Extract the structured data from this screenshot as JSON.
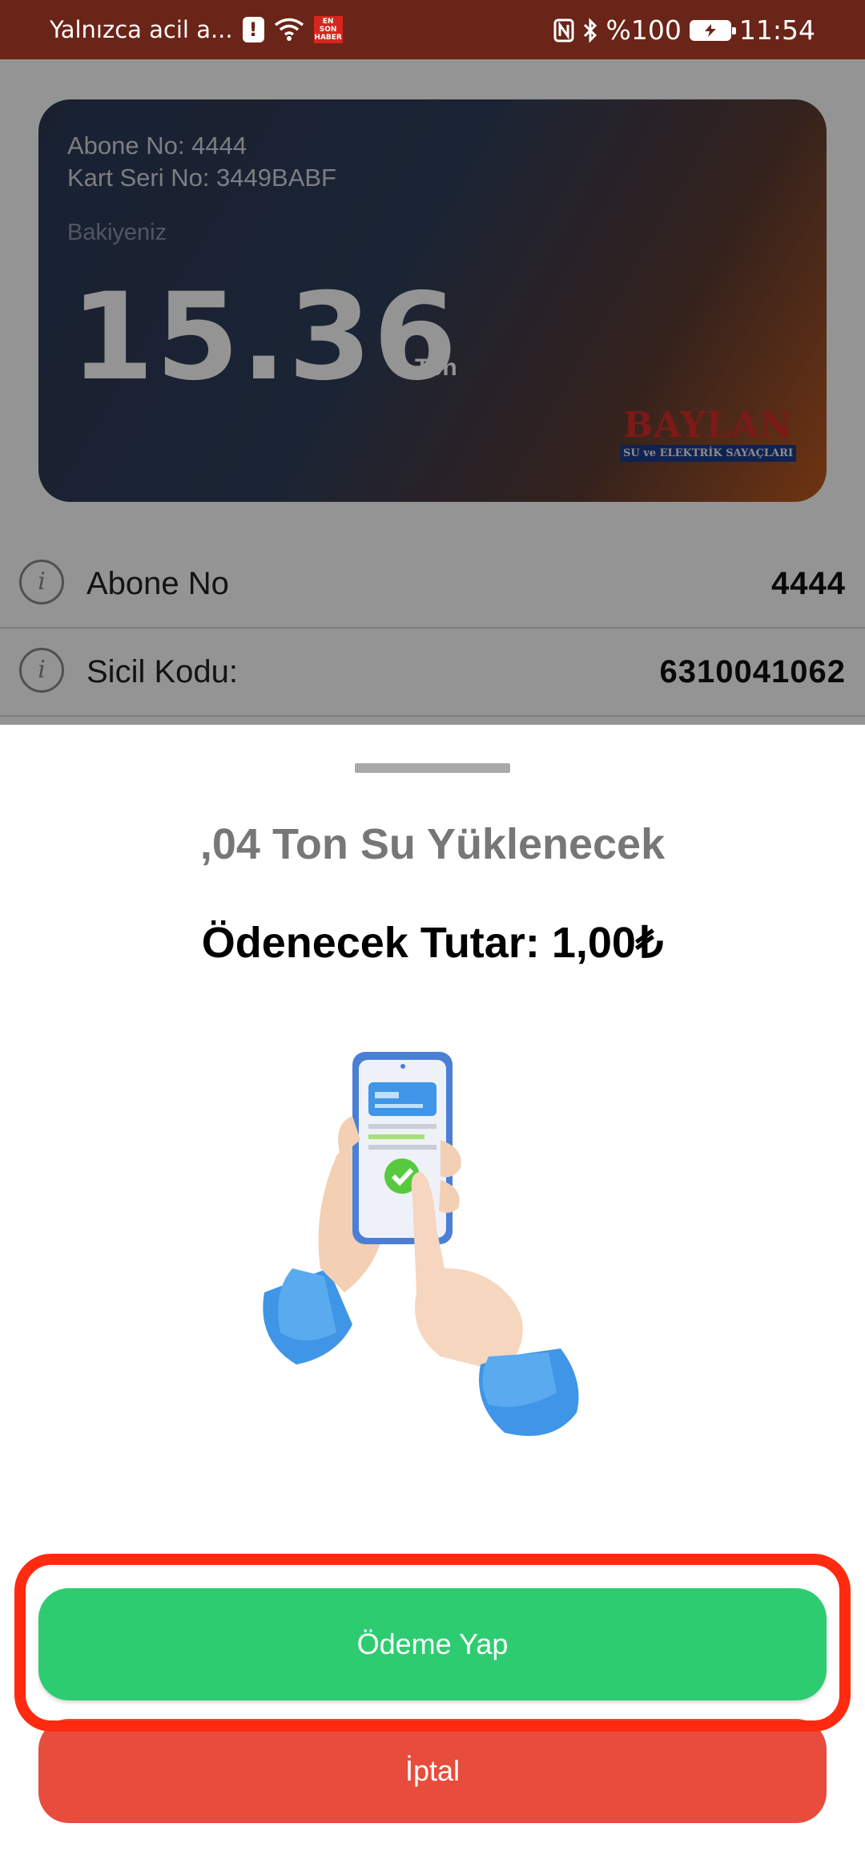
{
  "status_bar": {
    "notification_text": "Yalnızca acil a...",
    "alert_icon": "!",
    "news_badge": "EN SON HABER",
    "battery_text": "%100",
    "time": "11:54"
  },
  "card": {
    "subscriber_line": "Abone No: 4444",
    "card_serial_line": "Kart Seri No: 3449BABF",
    "balance_label": "Bakiyeniz",
    "balance_value": "15.36",
    "balance_unit": "Ton",
    "logo_text": "BAYLAN",
    "logo_subtext": "SU ve ELEKTRİK SAYAÇLARI"
  },
  "info_rows": [
    {
      "label": "Abone No",
      "value": "4444"
    },
    {
      "label": "Sicil Kodu:",
      "value": "6310041062"
    }
  ],
  "sheet": {
    "title": ",04 Ton Su Yüklenecek",
    "amount": "Ödenecek Tutar: 1,00₺",
    "pay_button": "Ödeme Yap",
    "cancel_button": "İptal"
  },
  "colors": {
    "status_bar": "#6b2418",
    "pay_button": "#2ecc71",
    "cancel_button": "#e74c3c",
    "highlight": "#ff2a10"
  }
}
